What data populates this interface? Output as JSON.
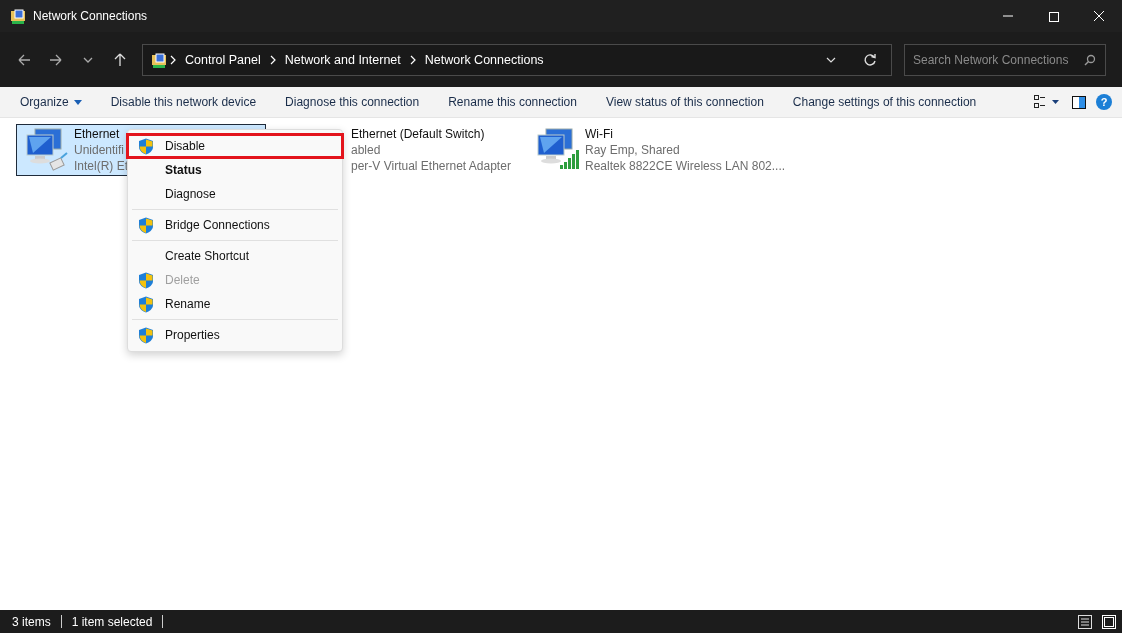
{
  "window": {
    "title": "Network Connections"
  },
  "address_bar": {
    "breadcrumbs": [
      "Control Panel",
      "Network and Internet",
      "Network Connections"
    ]
  },
  "search": {
    "placeholder": "Search Network Connections"
  },
  "commands": [
    {
      "label": "Organize",
      "dropdown": true
    },
    {
      "label": "Disable this network device",
      "dropdown": false
    },
    {
      "label": "Diagnose this connection",
      "dropdown": false
    },
    {
      "label": "Rename this connection",
      "dropdown": false
    },
    {
      "label": "View status of this connection",
      "dropdown": false
    },
    {
      "label": "Change settings of this connection",
      "dropdown": false
    }
  ],
  "help": "?",
  "connections": [
    {
      "kind": "wired",
      "name": "Ethernet",
      "status": "Unidentifi",
      "adapter": "Intel(R) Et",
      "selected": true
    },
    {
      "kind": "virtual",
      "name": "Ethernet (Default Switch)",
      "status": "abled",
      "adapter": "per-V Virtual Ethernet Adapter",
      "selected": false
    },
    {
      "kind": "wireless",
      "name": "Wi-Fi",
      "status": "Ray Emp, Shared",
      "adapter": "Realtek 8822CE Wireless LAN 802....",
      "selected": false
    }
  ],
  "context_menu": [
    {
      "kind": "item",
      "label": "Disable",
      "shield": true,
      "bold": false,
      "disabled": false,
      "highlighted": true
    },
    {
      "kind": "item",
      "label": "Status",
      "shield": false,
      "bold": true,
      "disabled": false,
      "highlighted": false
    },
    {
      "kind": "item",
      "label": "Diagnose",
      "shield": false,
      "bold": false,
      "disabled": false,
      "highlighted": false
    },
    {
      "kind": "separator"
    },
    {
      "kind": "item",
      "label": "Bridge Connections",
      "shield": true,
      "bold": false,
      "disabled": false,
      "highlighted": false
    },
    {
      "kind": "separator"
    },
    {
      "kind": "item",
      "label": "Create Shortcut",
      "shield": false,
      "bold": false,
      "disabled": false,
      "highlighted": false
    },
    {
      "kind": "item",
      "label": "Delete",
      "shield": true,
      "bold": false,
      "disabled": true,
      "highlighted": false
    },
    {
      "kind": "item",
      "label": "Rename",
      "shield": true,
      "bold": false,
      "disabled": false,
      "highlighted": false
    },
    {
      "kind": "separator"
    },
    {
      "kind": "item",
      "label": "Properties",
      "shield": true,
      "bold": false,
      "disabled": false,
      "highlighted": false
    }
  ],
  "status_bar": {
    "item_count": "3 items",
    "selection": "1 item selected"
  }
}
